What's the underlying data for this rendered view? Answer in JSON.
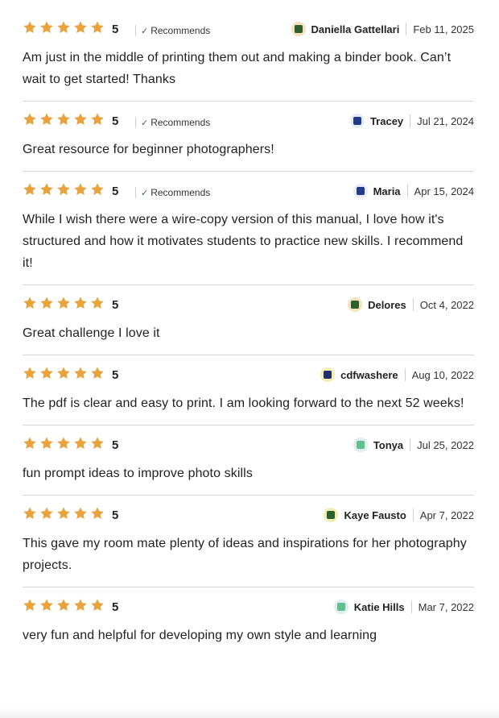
{
  "colors": {
    "star": "#E8A33D",
    "divider": "#D6D6D6",
    "check": "#2A6E3F"
  },
  "recommends_label": "Recommends",
  "reviews": [
    {
      "rating": "5",
      "recommends": true,
      "reviewer": "Daniella Gattellari",
      "date": "Feb 11, 2025",
      "avatar": {
        "bg": "#F6E2B8",
        "fg": "#2E5F2E"
      },
      "text": "Am just in the middle of printing them out and making a binder book. Can’t wait to get started! Thanks"
    },
    {
      "rating": "5",
      "recommends": true,
      "reviewer": "Tracey",
      "date": "Jul 21, 2024",
      "avatar": {
        "bg": "#E6EBF7",
        "fg": "#1F3C8C"
      },
      "text": "Great resource for beginner photographers!"
    },
    {
      "rating": "5",
      "recommends": true,
      "reviewer": "Maria",
      "date": "Apr 15, 2024",
      "avatar": {
        "bg": "#E6EBF7",
        "fg": "#1F3C8C"
      },
      "text": "While I wish there were a wire-copy version of this manual, I love how it's structured and how it motivates students to practice new skills. I recommend it!"
    },
    {
      "rating": "5",
      "recommends": false,
      "reviewer": "Delores",
      "date": "Oct 4, 2022",
      "avatar": {
        "bg": "#F6E2B8",
        "fg": "#2E5F2E"
      },
      "text": "Great challenge I love it"
    },
    {
      "rating": "5",
      "recommends": false,
      "reviewer": "cdfwashere",
      "date": "Aug 10, 2022",
      "avatar": {
        "bg": "#F3EDB0",
        "fg": "#1F2F6E"
      },
      "text": "The pdf is clear and easy to print. I am looking forward to the next 52 weeks!"
    },
    {
      "rating": "5",
      "recommends": false,
      "reviewer": "Tonya",
      "date": "Jul 25, 2022",
      "avatar": {
        "bg": "#DDF0EE",
        "fg": "#5FBF8F"
      },
      "text": "fun prompt ideas to improve photo skills"
    },
    {
      "rating": "5",
      "recommends": false,
      "reviewer": "Kaye Fausto",
      "date": "Apr 7, 2022",
      "avatar": {
        "bg": "#F3EDB0",
        "fg": "#2E5F2E"
      },
      "text": "This gave my room mate plenty of ideas and inspirations for her photography projects."
    },
    {
      "rating": "5",
      "recommends": false,
      "reviewer": "Katie Hills",
      "date": "Mar 7, 2022",
      "avatar": {
        "bg": "#DDF0EE",
        "fg": "#5FBF8F"
      },
      "text": "very fun and helpful for developing my own style and learning"
    }
  ]
}
